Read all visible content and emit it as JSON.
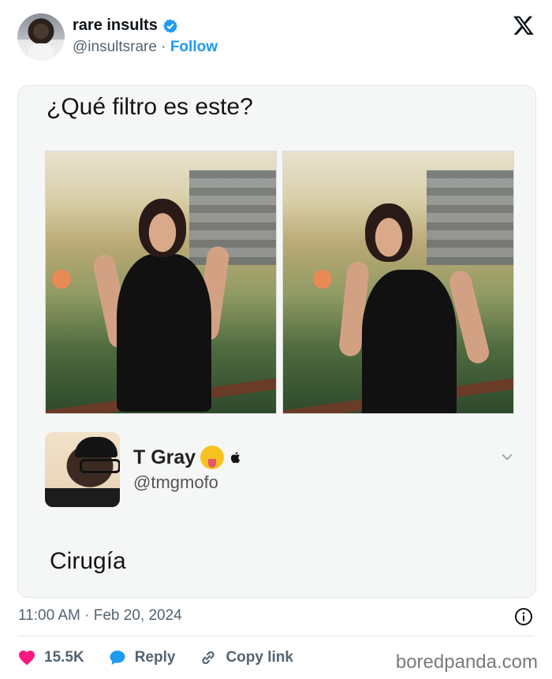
{
  "author": {
    "display_name": "rare insults",
    "handle": "@insultsrare",
    "separator": "·",
    "follow_label": "Follow",
    "verified_color": "#1d9bf0"
  },
  "post": {
    "question": "¿Qué filtro es este?",
    "reply": {
      "name": "T Gray",
      "handle": "@tmgmofo",
      "text": "Cirugía"
    },
    "timestamp": "11:00 AM · Feb 20, 2024"
  },
  "actions": {
    "likes": "15.5K",
    "reply_label": "Reply",
    "copy_link_label": "Copy link",
    "like_color": "#f91880",
    "reply_color": "#1d9bf0"
  },
  "watermark": "boredpanda.com",
  "icons": [
    "verified-badge-icon",
    "x-logo-icon",
    "tongue-emoji-icon",
    "apple-icon",
    "chevron-down-icon",
    "info-icon",
    "heart-icon",
    "reply-bubble-icon",
    "link-icon"
  ]
}
